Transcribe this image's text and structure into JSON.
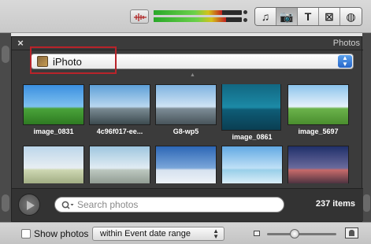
{
  "toolbar": {
    "buttons": [
      {
        "icon": "music-icon",
        "glyph": "♫"
      },
      {
        "icon": "camera-icon",
        "glyph": "📷",
        "active": true
      },
      {
        "icon": "text-icon",
        "glyph": "T"
      },
      {
        "icon": "transition-icon",
        "glyph": "⊠"
      },
      {
        "icon": "globe-icon",
        "glyph": "◍"
      }
    ],
    "meter_level_left": 0.78,
    "meter_level_right": 0.82
  },
  "panel": {
    "title": "Photos",
    "close_glyph": "×",
    "source": "iPhoto",
    "highlight_color": "#b8232a"
  },
  "photos": [
    {
      "caption": "image_0831",
      "colors": [
        "#3b8fe0",
        "#7fc1ef",
        "#4aa33a",
        "#2e7a22"
      ]
    },
    {
      "caption": "4c96f017-ee...",
      "colors": [
        "#5ea0d8",
        "#b9d7ef",
        "#7a8b93",
        "#3c4a4f"
      ]
    },
    {
      "caption": "G8-wp5",
      "colors": [
        "#7fb3e0",
        "#cfe3f4",
        "#7d8c96",
        "#48545a"
      ]
    },
    {
      "caption": "image_0861",
      "colors": [
        "#0f5f7a",
        "#1c8aa6",
        "#0e5c76",
        "#0a3e52"
      ],
      "selected": true
    },
    {
      "caption": "image_5697",
      "colors": [
        "#8cc4ec",
        "#e6f1fa",
        "#6bb34b",
        "#4a8d2e"
      ]
    },
    {
      "caption": "",
      "colors": [
        "#bcd6ea",
        "#e8eef2",
        "#cdd7b2",
        "#9aa67c"
      ]
    },
    {
      "caption": "",
      "colors": [
        "#9fc6df",
        "#e1ecf3",
        "#bcc7bf",
        "#8a958c"
      ]
    },
    {
      "caption": "",
      "colors": [
        "#2d67b6",
        "#7aa6d9",
        "#d6e2ef",
        "#f1f5f9"
      ]
    },
    {
      "caption": "",
      "colors": [
        "#62a9e3",
        "#bfe0f6",
        "#99cfe9",
        "#e5f3fb"
      ]
    },
    {
      "caption": "",
      "colors": [
        "#20306a",
        "#6a6a9c",
        "#c66a6a",
        "#3a2a3a"
      ]
    }
  ],
  "footer": {
    "search_placeholder": "Search photos",
    "count": "237 items"
  },
  "options": {
    "show_photos_label": "Show photos",
    "show_photos_checked": false,
    "range": "within Event date range",
    "thumb_size_level": 0.4
  }
}
